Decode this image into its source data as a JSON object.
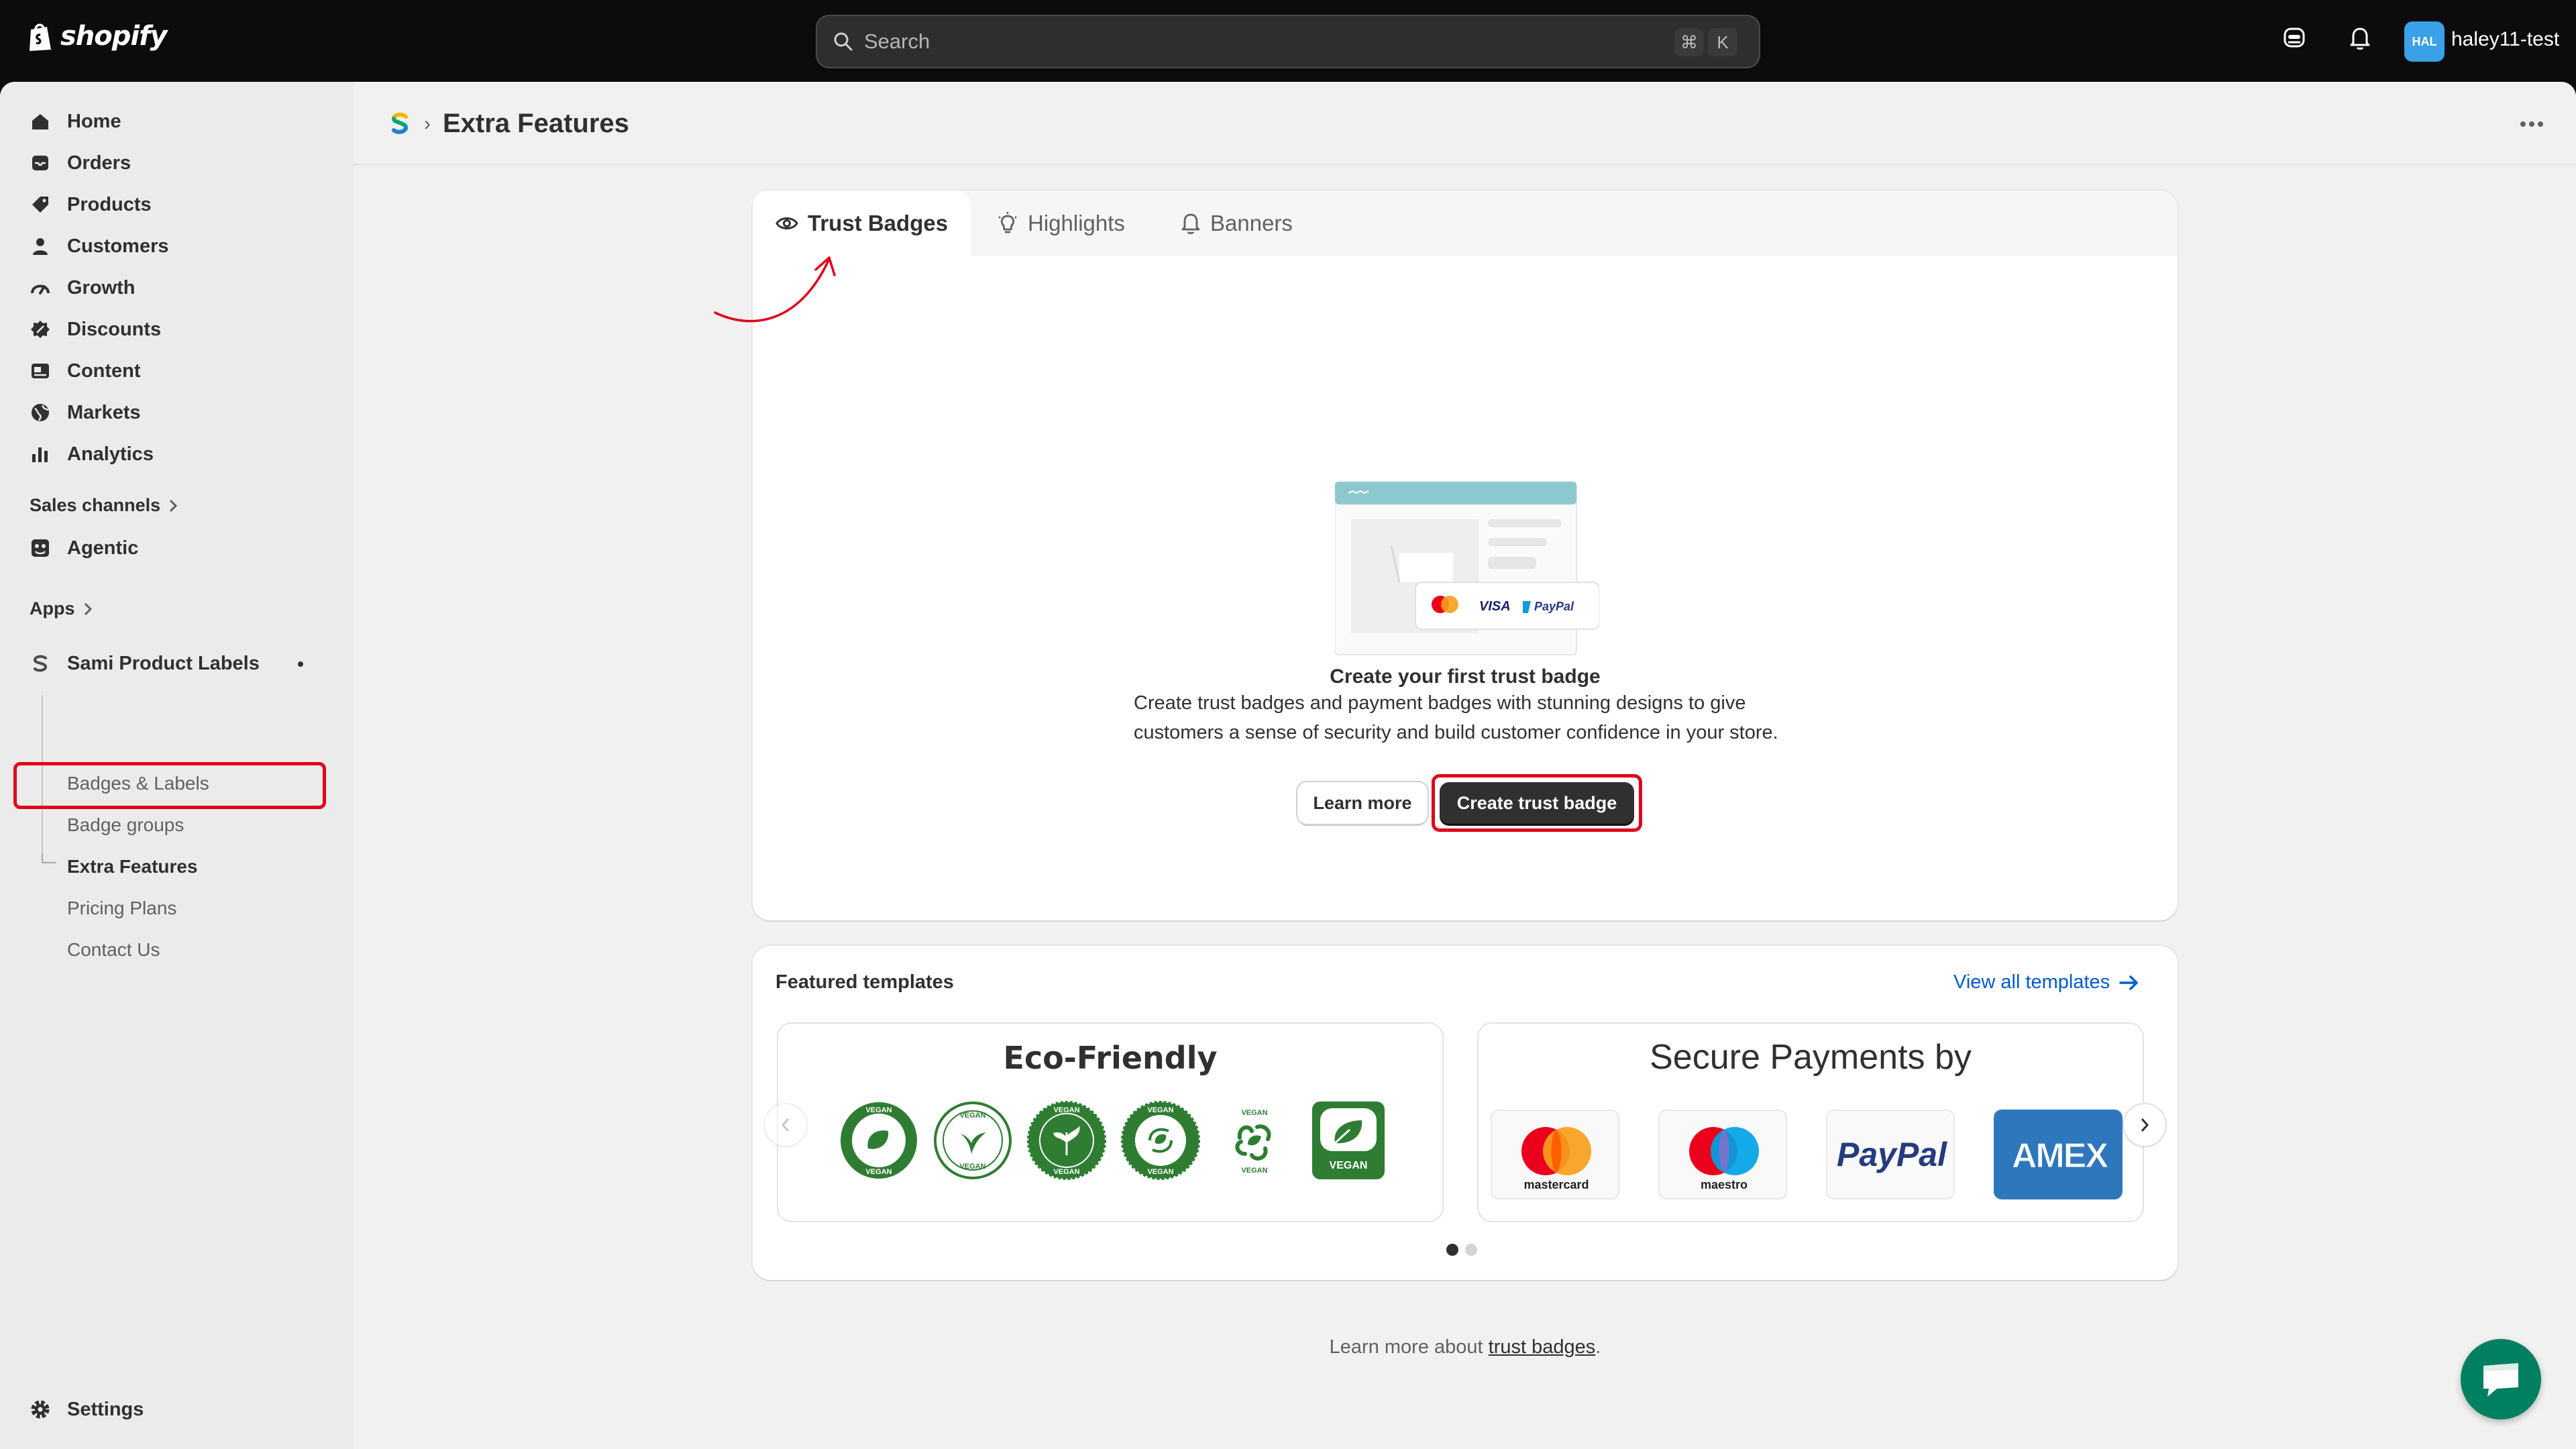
{
  "topbar": {
    "logo_text": "shopify",
    "search_placeholder": "Search",
    "shortcut_cmd": "⌘",
    "shortcut_key": "K",
    "avatar_initials": "HAL",
    "store_name": "haley11-test"
  },
  "sidebar": {
    "items": [
      {
        "label": "Home"
      },
      {
        "label": "Orders"
      },
      {
        "label": "Products"
      },
      {
        "label": "Customers"
      },
      {
        "label": "Growth"
      },
      {
        "label": "Discounts"
      },
      {
        "label": "Content"
      },
      {
        "label": "Markets"
      },
      {
        "label": "Analytics"
      }
    ],
    "sales_channels_label": "Sales channels",
    "agentic_label": "Agentic",
    "apps_label": "Apps",
    "app_name": "Sami Product Labels",
    "app_subitems": [
      {
        "label": "Badges & Labels"
      },
      {
        "label": "Badge groups"
      },
      {
        "label": "Extra Features"
      },
      {
        "label": "Pricing Plans"
      },
      {
        "label": "Contact Us"
      }
    ],
    "settings_label": "Settings"
  },
  "page": {
    "title": "Extra Features"
  },
  "tabs": [
    {
      "label": "Trust Badges",
      "active": true
    },
    {
      "label": "Highlights",
      "active": false
    },
    {
      "label": "Banners",
      "active": false
    }
  ],
  "empty_state": {
    "title": "Create your first trust badge",
    "description": "Create trust badges and payment badges with stunning designs to give customers a sense of security and build customer confidence in your store.",
    "learn_more": "Learn more",
    "create": "Create trust badge",
    "illustration_cards": [
      "VISA",
      "PayPal"
    ]
  },
  "featured": {
    "title": "Featured templates",
    "view_all": "View all templates",
    "templates": [
      {
        "title": "Eco-Friendly",
        "badge_text": "VEGAN"
      },
      {
        "title": "Secure Payments by",
        "payments": [
          "mastercard",
          "maestro",
          "PayPal",
          "AMEX"
        ]
      }
    ]
  },
  "footer": {
    "prefix": "Learn more about ",
    "link": "trust badges",
    "suffix": "."
  },
  "colors": {
    "accent_dark": "#303030",
    "link_blue": "#005bd3",
    "annotation_red": "#e0001a",
    "vegan_green": "#2e7d32",
    "chat_green": "#008060",
    "amex_blue": "#2e77bc"
  }
}
